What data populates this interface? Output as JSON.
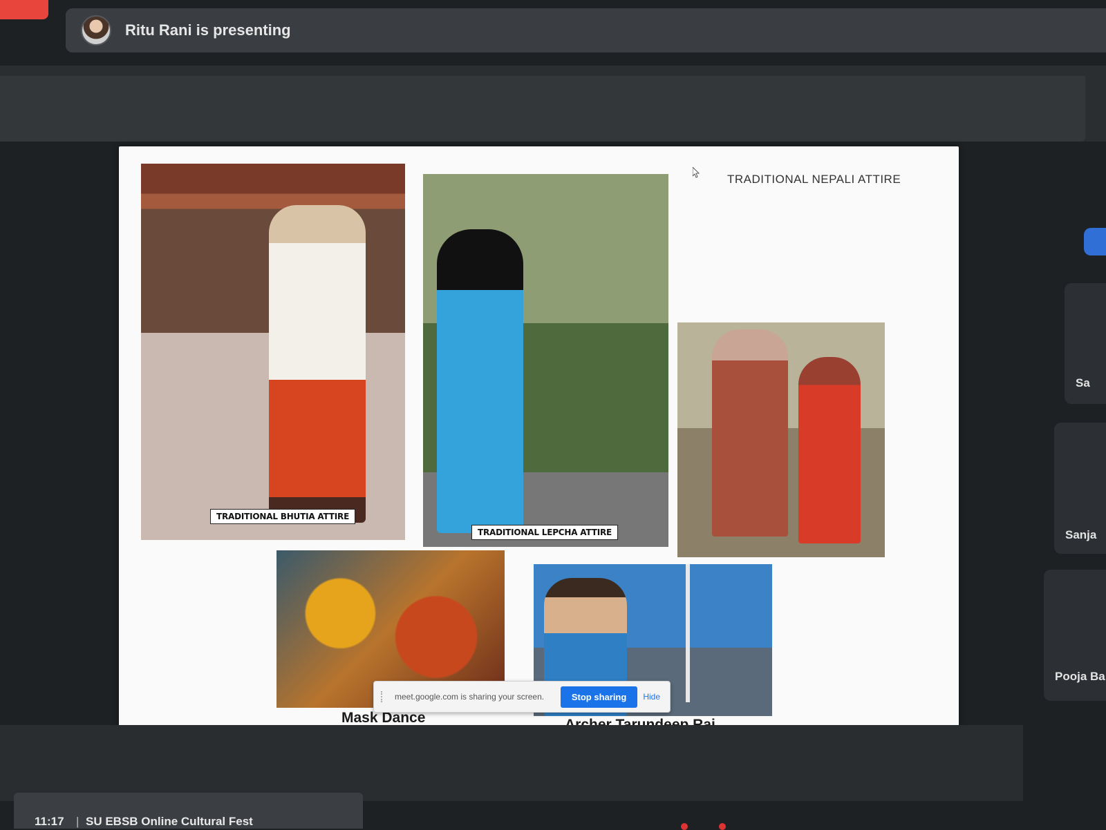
{
  "banner": {
    "presenting_text": "Ritu Rani is presenting"
  },
  "slide": {
    "title": "TRADITIONAL NEPALI ATTIRE",
    "tags": {
      "bhutia": "TRADITIONAL BHUTIA ATTIRE",
      "lepcha": "TRADITIONAL LEPCHA ATTIRE"
    },
    "captions": {
      "mask_dance": "Mask Dance",
      "archer": "Archer Tarundeep Rai"
    }
  },
  "share_notice": {
    "text": "meet.google.com is sharing your screen.",
    "stop_label": "Stop sharing",
    "hide_label": "Hide"
  },
  "participants": [
    {
      "name": "Sa"
    },
    {
      "name": "Sanja"
    },
    {
      "name": "Pooja Ba"
    }
  ],
  "taskbar": {
    "time": "11:17",
    "separator": "|",
    "meeting_title": "SU EBSB Online Cultural Fest"
  },
  "colors": {
    "accent": "#1a73e8",
    "record": "#e8453c"
  }
}
